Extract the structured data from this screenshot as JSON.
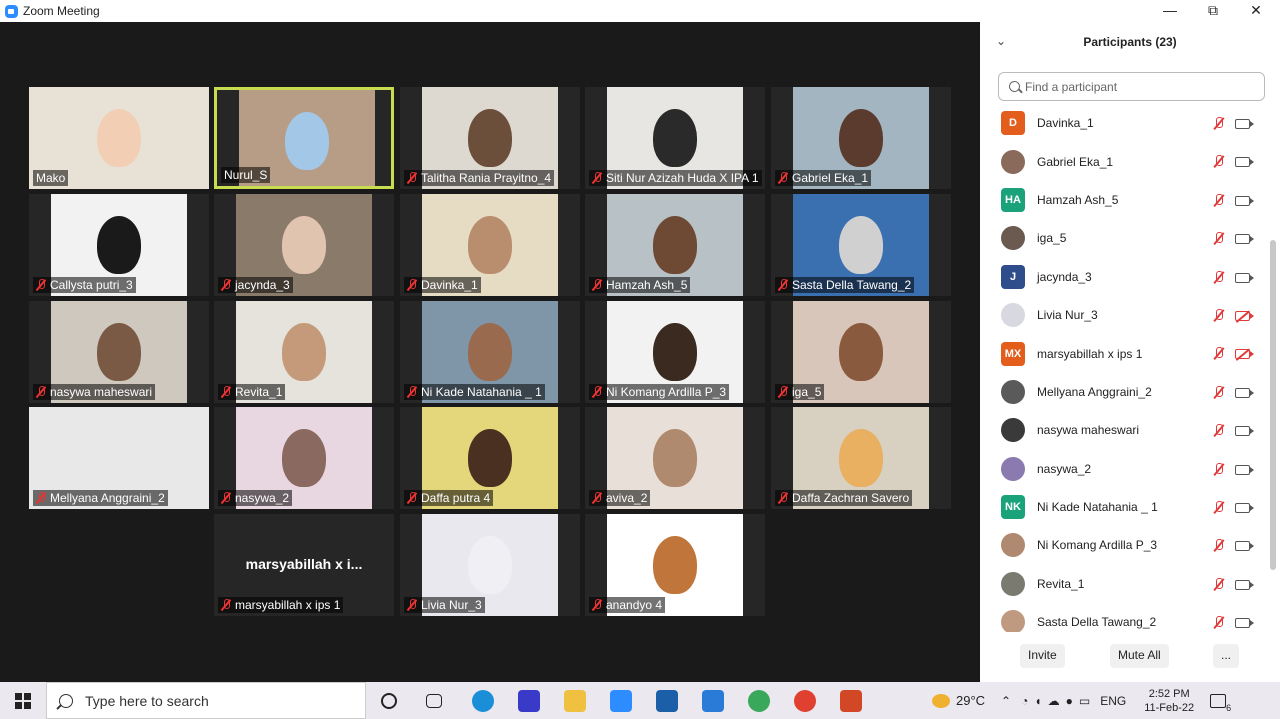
{
  "window": {
    "title": "Zoom Meeting",
    "minimize": "—",
    "restore": "⧉",
    "close": "✕"
  },
  "tiles": [
    {
      "label": "Mako",
      "muted": false,
      "active": false,
      "bg": "#e8e2d6",
      "face": "#f2cfb4"
    },
    {
      "label": "Nurul_S",
      "muted": false,
      "active": true,
      "bg": "#b89d86",
      "face": "#a3c7e6"
    },
    {
      "label": "Talitha Rania Prayitno_4",
      "muted": true,
      "active": false,
      "bg": "#ddd8d0",
      "face": "#6b4f3a"
    },
    {
      "label": "Siti Nur Azizah Huda X IPA 1",
      "muted": true,
      "active": false,
      "bg": "#e8e6e2",
      "face": "#2a2a2a"
    },
    {
      "label": "Gabriel Eka_1",
      "muted": true,
      "active": false,
      "bg": "#a3b5c0",
      "face": "#5a3b2e"
    },
    {
      "label": "Callysta putri_3",
      "muted": true,
      "active": false,
      "bg": "#f2f2f2",
      "face": "#1a1a1a"
    },
    {
      "label": "jacynda_3",
      "muted": true,
      "active": false,
      "bg": "#8a7a6a",
      "face": "#e0c4b0"
    },
    {
      "label": "Davinka_1",
      "muted": true,
      "active": false,
      "bg": "#e6dcc4",
      "face": "#b98e6e"
    },
    {
      "label": "Hamzah Ash_5",
      "muted": true,
      "active": false,
      "bg": "#b8c2c6",
      "face": "#6e4a34"
    },
    {
      "label": "Sasta Della Tawang_2",
      "muted": true,
      "active": false,
      "bg": "#3a6fb0",
      "face": "#d0d0d0"
    },
    {
      "label": "nasywa maheswari",
      "muted": true,
      "active": false,
      "bg": "#cfc8be",
      "face": "#7a5a44"
    },
    {
      "label": "Revita_1",
      "muted": true,
      "active": false,
      "bg": "#e6e2dc",
      "face": "#c49a7a"
    },
    {
      "label": "Ni Kade Natahania _ 1",
      "muted": true,
      "active": false,
      "bg": "#7f96a8",
      "face": "#9a6a4e"
    },
    {
      "label": "Ni Komang Ardilla P_3",
      "muted": true,
      "active": false,
      "bg": "#f2f2f2",
      "face": "#3a2a20"
    },
    {
      "label": "iga_5",
      "muted": true,
      "active": false,
      "bg": "#d8c6ba",
      "face": "#8a5a3e"
    },
    {
      "label": "Mellyana Anggraini_2",
      "muted": true,
      "active": false,
      "bg": "#e8e8e8",
      "face": "#e8e8e8"
    },
    {
      "label": "nasywa_2",
      "muted": true,
      "active": false,
      "bg": "#e8d6e0",
      "face": "#8a6a60"
    },
    {
      "label": "Daffa putra 4",
      "muted": true,
      "active": false,
      "bg": "#e4d67a",
      "face": "#4a3020"
    },
    {
      "label": "aviva_2",
      "muted": true,
      "active": false,
      "bg": "#e8e0d8",
      "face": "#b08a6e"
    },
    {
      "label": "Daffa Zachran Savero",
      "muted": true,
      "active": false,
      "bg": "#d8d0c0",
      "face": "#e8b060"
    },
    {
      "label": "marsyabillah x ips 1",
      "muted": true,
      "active": false,
      "bg": "#262626",
      "face": "",
      "name_display": "marsyabillah  x  i..."
    },
    {
      "label": "Livia Nur_3",
      "muted": true,
      "active": false,
      "bg": "#e8e8ee",
      "face": "#f0f0f4"
    },
    {
      "label": "anandyo 4",
      "muted": true,
      "active": false,
      "bg": "#ffffff",
      "face": "#c0763a"
    }
  ],
  "participants": {
    "title": "Participants (23)",
    "search_placeholder": "Find a participant",
    "items": [
      {
        "name": "Davinka_1",
        "initials": "D",
        "color": "#e35d1c",
        "video_off": false
      },
      {
        "name": "Gabriel Eka_1",
        "initials": "",
        "color": "#8a6a5a",
        "video_off": false
      },
      {
        "name": "Hamzah Ash_5",
        "initials": "HA",
        "color": "#1aa37a",
        "video_off": false
      },
      {
        "name": "iga_5",
        "initials": "",
        "color": "#6a5a50",
        "video_off": false
      },
      {
        "name": "jacynda_3",
        "initials": "J",
        "color": "#2f4d8a",
        "video_off": false
      },
      {
        "name": "Livia Nur_3",
        "initials": "",
        "color": "#d8d8e0",
        "video_off": true
      },
      {
        "name": "marsyabillah x ips 1",
        "initials": "MX",
        "color": "#e35d1c",
        "video_off": true
      },
      {
        "name": "Mellyana Anggraini_2",
        "initials": "",
        "color": "#5a5a5a",
        "video_off": false
      },
      {
        "name": "nasywa maheswari",
        "initials": "",
        "color": "#3a3a3a",
        "video_off": false
      },
      {
        "name": "nasywa_2",
        "initials": "",
        "color": "#8a7ab0",
        "video_off": false
      },
      {
        "name": "Ni Kade Natahania _ 1",
        "initials": "NK",
        "color": "#1aa37a",
        "video_off": false
      },
      {
        "name": "Ni Komang Ardilla P_3",
        "initials": "",
        "color": "#b08a70",
        "video_off": false
      },
      {
        "name": "Revita_1",
        "initials": "",
        "color": "#7a7a70",
        "video_off": false
      },
      {
        "name": "Sasta Della Tawang_2",
        "initials": "",
        "color": "#c09a80",
        "video_off": false
      }
    ],
    "invite": "Invite",
    "mute_all": "Mute All",
    "more": "..."
  },
  "taskbar": {
    "search_placeholder": "Type here to search",
    "temperature": "29°C",
    "language": "ENG",
    "time": "2:52 PM",
    "date": "11-Feb-22",
    "notification_count": "6"
  }
}
